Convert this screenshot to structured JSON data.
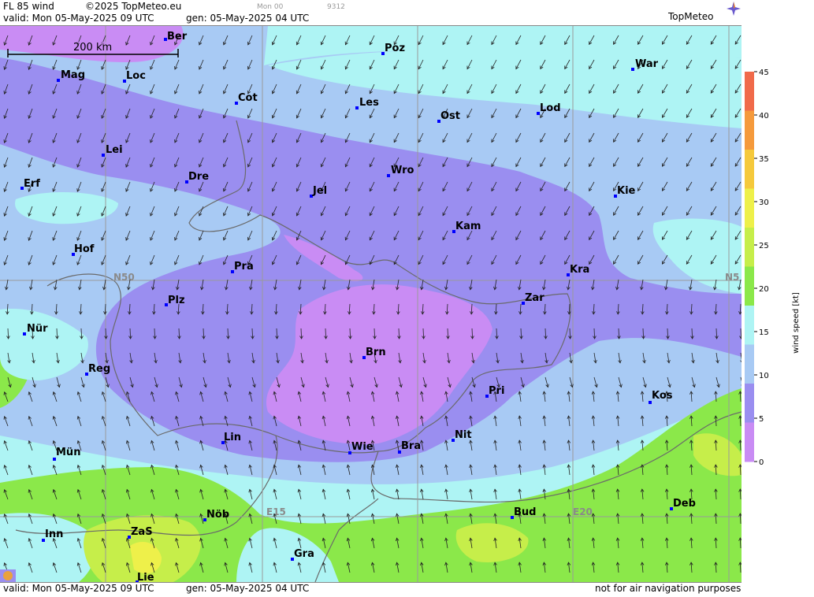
{
  "header": {
    "product": "FL 85 wind",
    "copyright": "©2025 TopMeteo.eu",
    "valid": "valid:  Mon  05-May-2025  09 UTC",
    "gen": "gen:  05-May-2025 04 UTC",
    "run_small": "Mon 00",
    "code_small": "9312",
    "logo": "TopMeteo"
  },
  "footer": {
    "valid": "valid:  Mon  05-May-2025  09 UTC",
    "gen": "gen:  05-May-2025 04 UTC",
    "disclaimer": "not for air navigation purposes"
  },
  "scale_bar": {
    "label": "200 km"
  },
  "grid_labels": {
    "lat50": "N50",
    "lat50_right": "N5",
    "lon15": "E15",
    "lon20": "E20"
  },
  "legend": {
    "title": "wind speed [kt]",
    "ticks": [
      "45",
      "40",
      "35",
      "30",
      "25",
      "20",
      "15",
      "10",
      "5",
      "0"
    ],
    "colors": [
      "#f06a4a",
      "#f59a3c",
      "#f5c93c",
      "#eef04a",
      "#c6ee4a",
      "#8be84a",
      "#aef4f4",
      "#a8caf4",
      "#9a8ef0",
      "#c98cf4"
    ]
  },
  "cities": [
    {
      "name": "Ber"
    },
    {
      "name": "Poz"
    },
    {
      "name": "War"
    },
    {
      "name": "Mag"
    },
    {
      "name": "Loc"
    },
    {
      "name": "Cot"
    },
    {
      "name": "Les"
    },
    {
      "name": "Ost"
    },
    {
      "name": "Lod"
    },
    {
      "name": "Lei"
    },
    {
      "name": "Wro"
    },
    {
      "name": "Erf"
    },
    {
      "name": "Dre"
    },
    {
      "name": "Jel"
    },
    {
      "name": "Kie"
    },
    {
      "name": "Kam"
    },
    {
      "name": "Hof"
    },
    {
      "name": "Pra"
    },
    {
      "name": "Kra"
    },
    {
      "name": "Zar"
    },
    {
      "name": "Plz"
    },
    {
      "name": "Nür"
    },
    {
      "name": "Brn"
    },
    {
      "name": "Reg"
    },
    {
      "name": "Pri"
    },
    {
      "name": "Kos"
    },
    {
      "name": "Lin"
    },
    {
      "name": "Nit"
    },
    {
      "name": "Wie"
    },
    {
      "name": "Bra"
    },
    {
      "name": "Mün"
    },
    {
      "name": "Deb"
    },
    {
      "name": "Nöb"
    },
    {
      "name": "Bud"
    },
    {
      "name": "Inn"
    },
    {
      "name": "ZaS"
    },
    {
      "name": "Gra"
    },
    {
      "name": "Lie"
    }
  ]
}
